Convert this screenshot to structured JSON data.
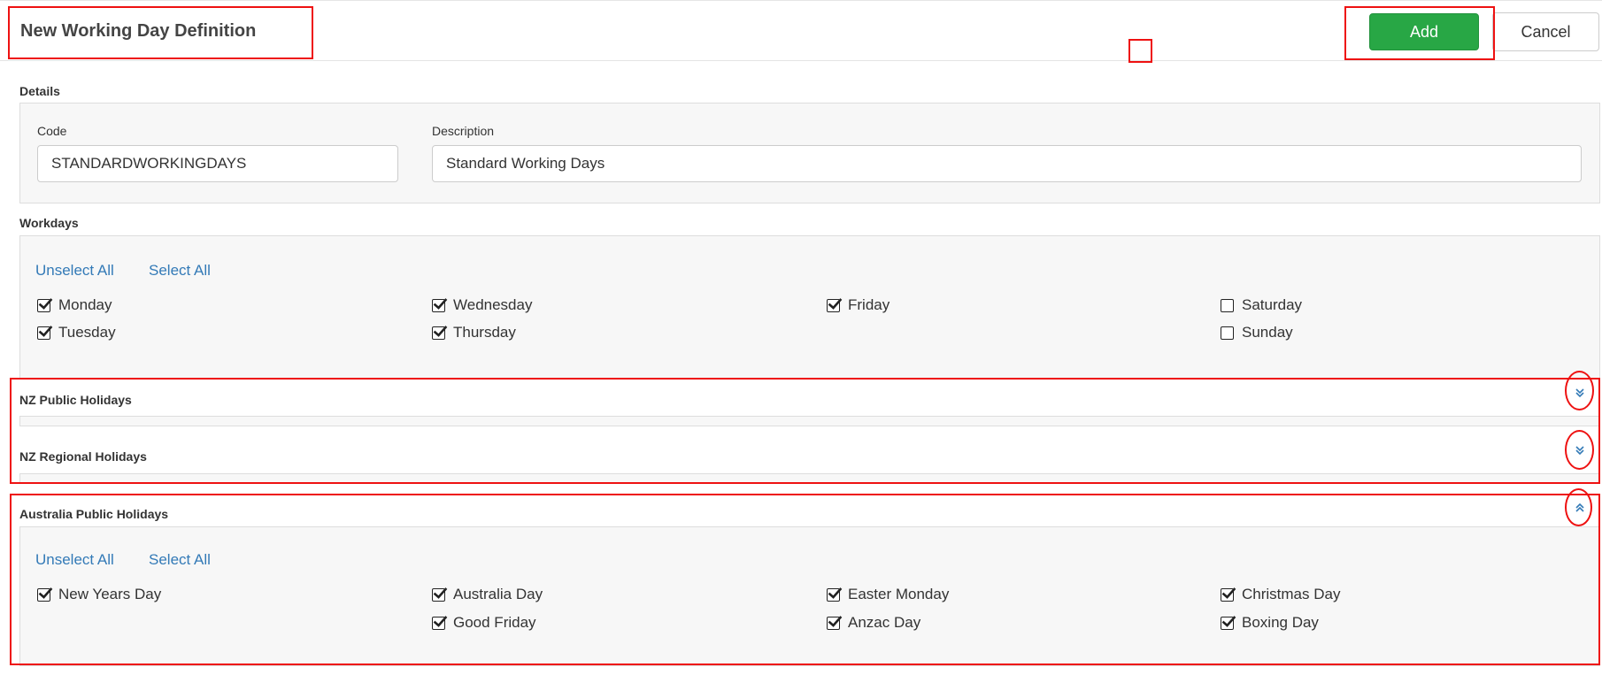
{
  "header": {
    "title": "New Working Day Definition",
    "add_label": "Add",
    "cancel_label": "Cancel"
  },
  "details": {
    "section_label": "Details",
    "code_label": "Code",
    "code_value": "STANDARDWORKINGDAYS",
    "description_label": "Description",
    "description_value": "Standard Working Days"
  },
  "workdays": {
    "section_label": "Workdays",
    "unselect_all": "Unselect All",
    "select_all": "Select All",
    "days": [
      {
        "label": "Monday",
        "checked": true
      },
      {
        "label": "Tuesday",
        "checked": true
      },
      {
        "label": "Wednesday",
        "checked": true
      },
      {
        "label": "Thursday",
        "checked": true
      },
      {
        "label": "Friday",
        "checked": true
      },
      {
        "label": "Saturday",
        "checked": false
      },
      {
        "label": "Sunday",
        "checked": false
      }
    ]
  },
  "nz_public_holidays": {
    "title": "NZ Public Holidays",
    "toggle_icon": "chevron-double-down-icon"
  },
  "nz_regional_holidays": {
    "title": "NZ Regional Holidays",
    "toggle_icon": "chevron-double-down-icon"
  },
  "australia_public_holidays": {
    "title": "Australia Public Holidays",
    "toggle_icon": "chevron-double-up-icon",
    "unselect_all": "Unselect All",
    "select_all": "Select All",
    "holidays": [
      {
        "label": "New Years Day",
        "checked": true
      },
      {
        "label": "Australia Day",
        "checked": true
      },
      {
        "label": "Good Friday",
        "checked": true
      },
      {
        "label": "Easter Monday",
        "checked": true
      },
      {
        "label": "Anzac Day",
        "checked": true
      },
      {
        "label": "Christmas Day",
        "checked": true
      },
      {
        "label": "Boxing Day",
        "checked": true
      }
    ]
  },
  "colors": {
    "accent": "#28a745",
    "link": "#337ab7",
    "annotation": "#ee1111",
    "panel_bg": "#f7f7f7"
  }
}
